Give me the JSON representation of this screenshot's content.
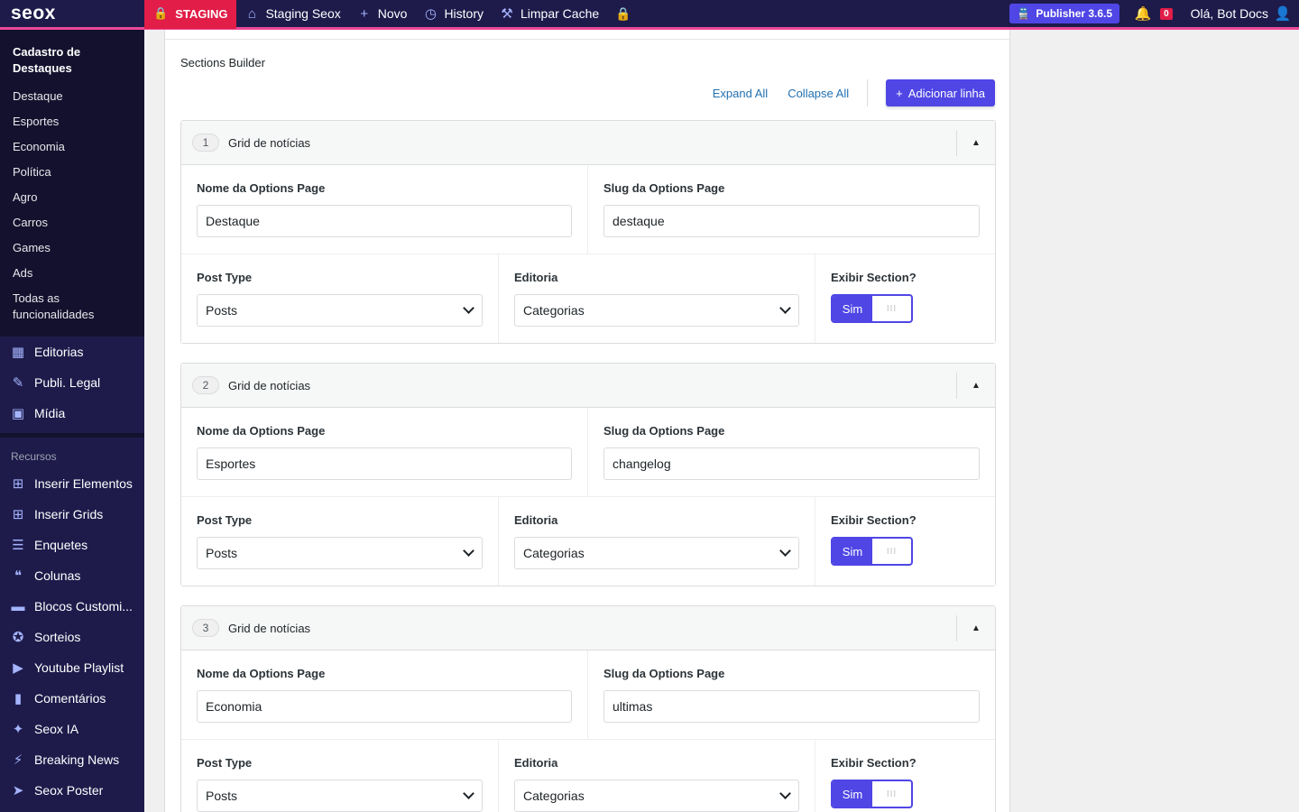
{
  "topbar": {
    "logo": "seox",
    "staging": "STAGING",
    "site": "Staging Seox",
    "new": "Novo",
    "history": "History",
    "cache": "Limpar Cache",
    "publisher": "Publisher 3.6.5",
    "notifications": "0",
    "greeting": "Olá, Bot Docs"
  },
  "sidebar": {
    "submenu_title": "Cadastro de Destaques",
    "submenu_items": [
      "Destaque",
      "Esportes",
      "Economia",
      "Política",
      "Agro",
      "Carros",
      "Games",
      "Ads",
      "Todas as funcionalidades"
    ],
    "menu": [
      "Editorias",
      "Publi. Legal",
      "Mídia"
    ],
    "section_label": "Recursos",
    "resources": [
      "Inserir Elementos",
      "Inserir Grids",
      "Enquetes",
      "Colunas",
      "Blocos Customi...",
      "Sorteios",
      "Youtube Playlist",
      "Comentários",
      "Seox IA",
      "Breaking News",
      "Seox Poster"
    ]
  },
  "builder": {
    "title": "Sections Builder",
    "expand_all": "Expand All",
    "collapse_all": "Collapse All",
    "add_row": "Adicionar linha",
    "labels": {
      "name": "Nome da Options Page",
      "slug": "Slug da Options Page",
      "post_type": "Post Type",
      "editoria": "Editoria",
      "show": "Exibir Section?"
    },
    "rows": [
      {
        "num": "1",
        "title": "Grid de notícias",
        "name": "Destaque",
        "slug": "destaque",
        "post_type": "Posts",
        "editoria": "Categorias",
        "show": "Sim"
      },
      {
        "num": "2",
        "title": "Grid de notícias",
        "name": "Esportes",
        "slug": "changelog",
        "post_type": "Posts",
        "editoria": "Categorias",
        "show": "Sim"
      },
      {
        "num": "3",
        "title": "Grid de notícias",
        "name": "Economia",
        "slug": "ultimas",
        "post_type": "Posts",
        "editoria": "Categorias",
        "show": "Sim"
      }
    ]
  },
  "colors": {
    "accent": "#4f46e5",
    "admin_bar": "#1e1b4b",
    "staging": "#e11d48",
    "link": "#2271b1"
  }
}
